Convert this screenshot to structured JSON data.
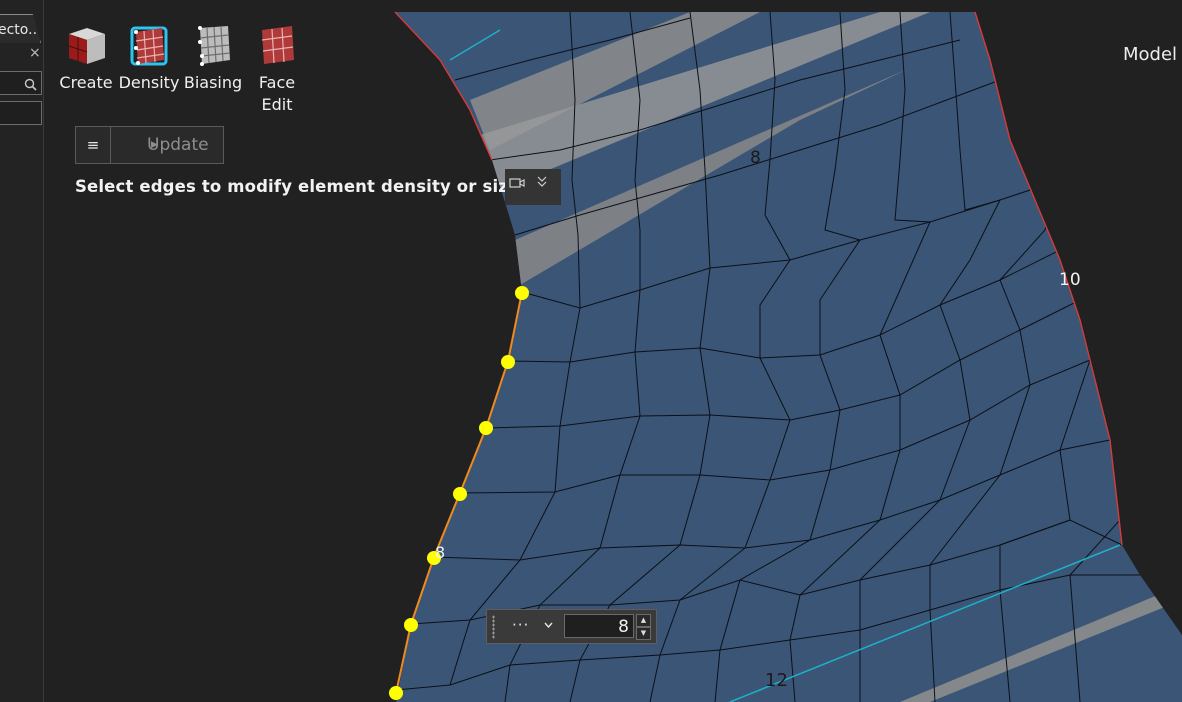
{
  "left_panel": {
    "tab_label": "ecto...",
    "close_glyph": "×",
    "search_icon": "search-icon"
  },
  "toolbar": {
    "tools": [
      {
        "label": "Create",
        "icon": "create-icon"
      },
      {
        "label": "Density",
        "icon": "density-icon",
        "active": true
      },
      {
        "label": "Biasing",
        "icon": "biasing-icon"
      },
      {
        "label": "Face Edit",
        "label_line1": "Face",
        "label_line2": "Edit",
        "icon": "face-edit-icon"
      }
    ]
  },
  "guide_bar": {
    "menu_glyph": "≡",
    "update_label": "Update"
  },
  "status": {
    "message": "Select edges to modify element density or size.",
    "camera_icon": "camera-icon",
    "expand_icon": "chevron-double-down-icon"
  },
  "viewport": {
    "model_label": "Model",
    "edge_labels": [
      "8",
      "10",
      "8",
      "12"
    ],
    "colors": {
      "mesh_face": "#3a5576",
      "mesh_line": "#0c1016",
      "selected_edge": "#ef8a1f",
      "handle": "#ffff00",
      "boundary": "#d83a3a",
      "highlight": "#1fb0c8"
    }
  },
  "microdialog": {
    "options_glyph": "···",
    "value": "8"
  }
}
